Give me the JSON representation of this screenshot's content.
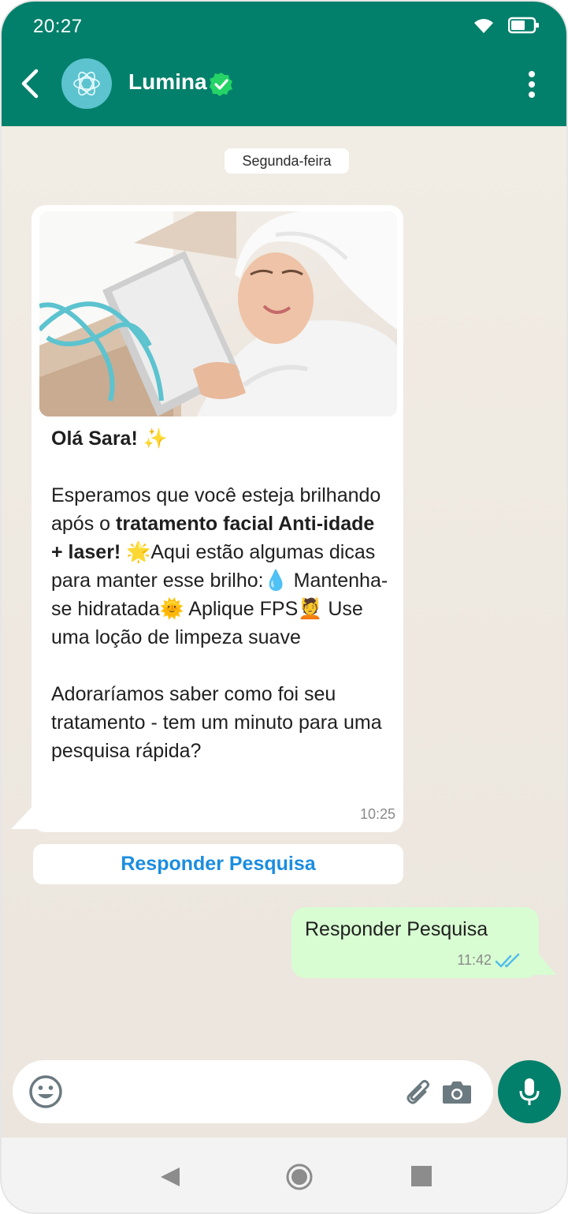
{
  "status_bar": {
    "time": "20:27",
    "wifi_icon": "wifi-icon",
    "battery_icon": "battery-icon"
  },
  "header": {
    "contact_name": "Lumina",
    "verified_icon": "verified-badge-icon",
    "back_icon": "back-arrow-icon",
    "menu_icon": "more-vert-icon",
    "brand_color": "#03806b"
  },
  "chat": {
    "date_chip": "Segunda-feira",
    "incoming": {
      "greeting": "Olá Sara! ✨",
      "p1_a": "Esperamos que você esteja brilhando após o ",
      "p1_bold": "tratamento facial Anti-idade + laser!",
      "p1_b": " 🌟Aqui estão algumas dicas para manter esse brilho:💧 Mantenha-se hidratada🌞 Aplique FPS💆 Use uma loção de limpeza suave",
      "p2": "Adoraríamos saber como foi seu tratamento - tem um minuto para uma pesquisa rápida?",
      "time": "10:25"
    },
    "action_button": "Responder Pesquisa",
    "outgoing": {
      "text": "Responder Pesquisa",
      "time": "11:42",
      "ticks_icon": "double-check-icon",
      "ticks_color": "#53bdeb"
    }
  },
  "composer": {
    "placeholder": "",
    "emoji_icon": "emoji-icon",
    "attach_icon": "paperclip-icon",
    "camera_icon": "camera-icon",
    "mic_icon": "mic-icon"
  },
  "navbar": {
    "back": "nav-back-icon",
    "home": "nav-home-icon",
    "recent": "nav-recent-icon"
  }
}
